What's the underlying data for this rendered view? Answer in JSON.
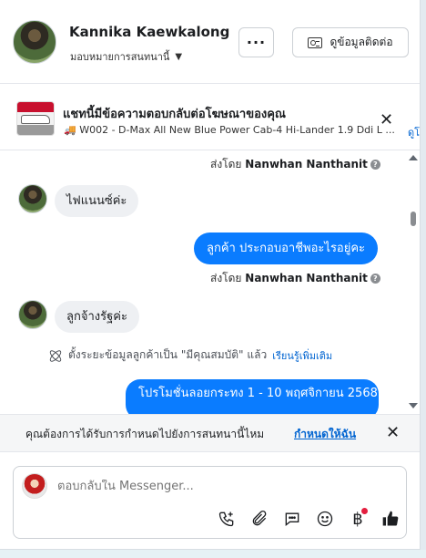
{
  "header": {
    "user_name": "Kannika Kaewkalong",
    "assign_label": "มอบหมายการสนทนานี้",
    "more_label": "···",
    "contact_label": "ดูข้อมูลติดต่อ"
  },
  "ad": {
    "title": "แชทนี้มีข้อความตอบกลับต่อโฆษณาของคุณ",
    "subtitle": "W002 - D-Max All New Blue Power Cab-4 Hi-Lander 1.9 Ddi L ...",
    "link": "ดูโ"
  },
  "chat": {
    "sent_by_prefix": "ส่งโดย",
    "sender": "Nanwhan Nanthanit",
    "messages": [
      {
        "from": "customer",
        "text": "ไฟแนนซ์ค่ะ"
      },
      {
        "from": "page",
        "text": "ลูกค้า  ประกอบอาชีพอะไรอยู่คะ"
      },
      {
        "from": "customer",
        "text": "ลูกจ้างรัฐค่ะ"
      },
      {
        "from": "page",
        "text": "โปรโมชั่นลอยกระทง 1 - 10 พฤศจิกายน 2568"
      }
    ],
    "system_text": "ตั้งระยะข้อมูลลูกค้าเป็น \"มีคุณสมบัติ\" แล้ว",
    "system_link": "เรียนรู้เพิ่มเติม"
  },
  "prompt": {
    "text": "คุณต้องการได้รับการกำหนดไปยังการสนทนานี้ไหม",
    "link": "กำหนดให้ฉัน"
  },
  "composer": {
    "placeholder": "ตอบกลับใน Messenger..."
  },
  "colors": {
    "accent": "#0a7cff",
    "link": "#0064d1",
    "incoming_bubble": "#eef0f3"
  }
}
